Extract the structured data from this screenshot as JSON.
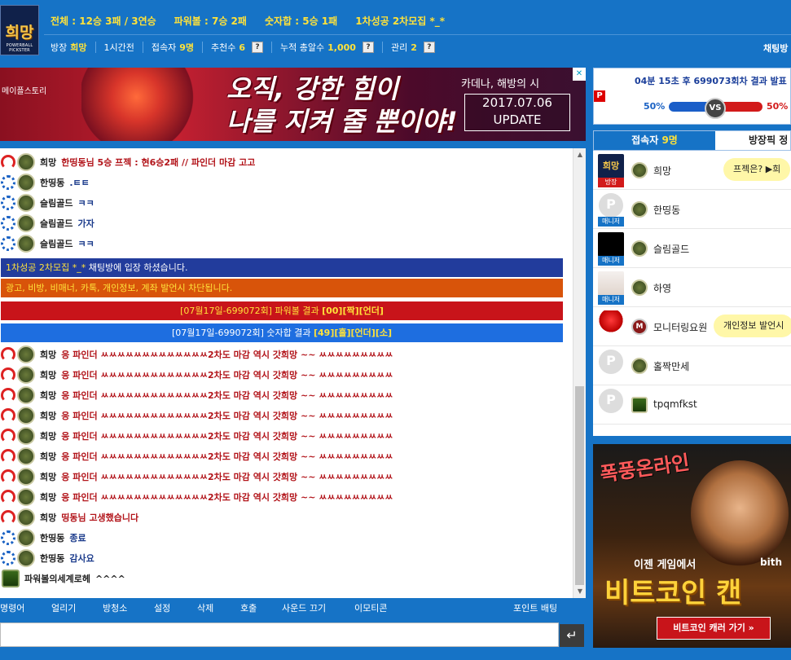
{
  "header": {
    "logo_text": "희망",
    "logo_sub": "POWERBALL PICKSTER",
    "stats": [
      "전체 : 12승 3패 / 3연승",
      "파워볼 : 7승 2패",
      "숫자합 : 5승 1패",
      "1차성공 2차모집 *_*"
    ],
    "info": {
      "owner_label": "방장",
      "owner_value": "희망",
      "time_label": "1시간전",
      "users_label": "접속자",
      "users_value": "9명",
      "rec_label": "추천수",
      "rec_value": "6",
      "total_label": "누적 총알수",
      "total_value": "1,000",
      "admin_label": "관리",
      "admin_value": "2",
      "help": "?"
    },
    "chatroom_label": "채팅방"
  },
  "banner": {
    "brand": "메이플스토리",
    "copy_line1": "오직, 강한 힘이",
    "copy_line2": "나를 지켜 줄 뿐이야!",
    "sub": "카데나, 해방의 시",
    "date": "2017.07.06",
    "update": "UPDATE",
    "ad_mark": "✕"
  },
  "chat": {
    "rows": [
      {
        "nick": "희망",
        "msg": "한띵동님 5승 프젝 : 현6승2패 // 파인더 마감 고고",
        "tone": "red",
        "style": "red"
      },
      {
        "nick": "한띵동",
        "msg": ".ㅌㅌ",
        "tone": "blue",
        "style": "navy"
      },
      {
        "nick": "슬림골드",
        "msg": "ㅋㅋ",
        "tone": "blue",
        "style": "navy"
      },
      {
        "nick": "슬림골드",
        "msg": "가자",
        "tone": "blue",
        "style": "navy"
      },
      {
        "nick": "슬림골드",
        "msg": "ㅋㅋ",
        "tone": "blue",
        "style": "navy"
      }
    ],
    "sys1_a": "1차성공 2차모집 *_*",
    "sys1_b": " 채팅방에 입장 하셨습니다.",
    "sys2": "광고, 비방, 비매너, 카톡, 개인정보, 계좌 발언시 차단됩니다.",
    "sys3_a": "[07월17일-699072회] 파워볼 결과 ",
    "sys3_b": "[00][짝][언더]",
    "sys4_a": "[07월17일-699072회] 숫자합 결과 ",
    "sys4_b": "[49][홀][언더][소]",
    "rows2": [
      {
        "nick": "희망",
        "msg": "응 파인더 ㅆㅆㅆㅆㅆㅆㅆㅆㅆㅆㅆㅆㅆ2차도 마감 역시 갓희망 ~~ ㅆㅆㅆㅆㅆㅆㅆㅆㅆ",
        "tone": "red",
        "style": "red"
      },
      {
        "nick": "희망",
        "msg": "응 파인더 ㅆㅆㅆㅆㅆㅆㅆㅆㅆㅆㅆㅆㅆ2차도 마감 역시 갓희망 ~~ ㅆㅆㅆㅆㅆㅆㅆㅆㅆ",
        "tone": "red",
        "style": "red"
      },
      {
        "nick": "희망",
        "msg": "응 파인더 ㅆㅆㅆㅆㅆㅆㅆㅆㅆㅆㅆㅆㅆ2차도 마감 역시 갓희망 ~~ ㅆㅆㅆㅆㅆㅆㅆㅆㅆ",
        "tone": "red",
        "style": "red"
      },
      {
        "nick": "희망",
        "msg": "응 파인더 ㅆㅆㅆㅆㅆㅆㅆㅆㅆㅆㅆㅆㅆ2차도 마감 역시 갓희망 ~~ ㅆㅆㅆㅆㅆㅆㅆㅆㅆ",
        "tone": "red",
        "style": "red"
      },
      {
        "nick": "희망",
        "msg": "응 파인더 ㅆㅆㅆㅆㅆㅆㅆㅆㅆㅆㅆㅆㅆ2차도 마감 역시 갓희망 ~~ ㅆㅆㅆㅆㅆㅆㅆㅆㅆ",
        "tone": "red",
        "style": "red"
      },
      {
        "nick": "희망",
        "msg": "응 파인더 ㅆㅆㅆㅆㅆㅆㅆㅆㅆㅆㅆㅆㅆ2차도 마감 역시 갓희망 ~~ ㅆㅆㅆㅆㅆㅆㅆㅆㅆ",
        "tone": "red",
        "style": "red"
      },
      {
        "nick": "희망",
        "msg": "응 파인더 ㅆㅆㅆㅆㅆㅆㅆㅆㅆㅆㅆㅆㅆ2차도 마감 역시 갓희망 ~~ ㅆㅆㅆㅆㅆㅆㅆㅆㅆ",
        "tone": "red",
        "style": "red"
      },
      {
        "nick": "희망",
        "msg": "응 파인더 ㅆㅆㅆㅆㅆㅆㅆㅆㅆㅆㅆㅆㅆ2차도 마감 역시 갓희망 ~~ ㅆㅆㅆㅆㅆㅆㅆㅆㅆ",
        "tone": "red",
        "style": "red"
      },
      {
        "nick": "희망",
        "msg": "띵동님 고생했습니다",
        "tone": "red",
        "style": "red"
      },
      {
        "nick": "한띵동",
        "msg": "종료",
        "tone": "blue",
        "style": "navy"
      },
      {
        "nick": "한띵동",
        "msg": "감사요",
        "tone": "blue",
        "style": "navy"
      },
      {
        "nick": "파워볼의세계로헤",
        "msg": "^^^^",
        "tone": "none",
        "style": "dk"
      }
    ]
  },
  "menu": [
    "명령어",
    "얼리기",
    "방청소",
    "설정",
    "삭제",
    "호출",
    "사운드 끄기",
    "이모티콘",
    "포인트 배팅"
  ],
  "send_icon": "↵",
  "result": {
    "title": "04분 15초 후 699073회차 결과 발표",
    "left_pct": "50%",
    "right_pct": "50%",
    "vs": "VS",
    "p": "P"
  },
  "tabs": {
    "users_label": "접속자",
    "users_count": "9명",
    "pick_label": "방장픽 정"
  },
  "users": [
    {
      "name": "희망",
      "role": "방장",
      "bubble": "프젝은? ▶희"
    },
    {
      "name": "한띵동",
      "role": "매니저",
      "bubble": ""
    },
    {
      "name": "슬림골드",
      "role": "매니저",
      "bubble": ""
    },
    {
      "name": "하영",
      "role": "매니저",
      "bubble": ""
    },
    {
      "name": "모니터링요원",
      "role": "",
      "bubble": "개인정보 발언시"
    },
    {
      "name": "홀짝만세",
      "role": "",
      "bubble": ""
    },
    {
      "name": "tpqmfkst",
      "role": "",
      "bubble": ""
    }
  ],
  "ad2": {
    "title": "폭풍온라인",
    "line1": "이젠 게임에서",
    "bith": "bith",
    "line2": "비트코인 캔",
    "btn": "비트코인 캐러 가기 »"
  },
  "colors": {
    "bg": "#1673c6",
    "accent": "#ffe23a",
    "red": "#b2141a"
  }
}
